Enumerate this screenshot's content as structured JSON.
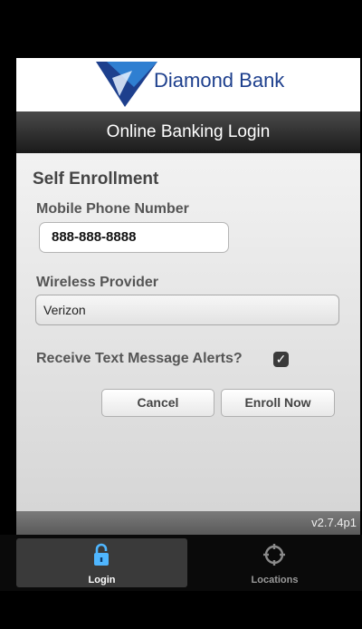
{
  "app": {
    "brand_name": "Diamond Bank",
    "page_title": "Online Banking Login",
    "version": "v2.7.4p1"
  },
  "form": {
    "section_title": "Self Enrollment",
    "phone_label": "Mobile Phone Number",
    "phone_value": "888-888-8888",
    "provider_label": "Wireless Provider",
    "provider_value": "Verizon",
    "alerts_label": "Receive Text Message Alerts?",
    "alerts_checked": true,
    "cancel_label": "Cancel",
    "enroll_label": "Enroll Now"
  },
  "tabs": [
    {
      "label": "Login",
      "icon": "lock-icon",
      "active": true
    },
    {
      "label": "Locations",
      "icon": "crosshair-icon",
      "active": false
    }
  ],
  "colors": {
    "brand_blue": "#1d3f8d",
    "tab_active_icon": "#4fb6ff"
  }
}
